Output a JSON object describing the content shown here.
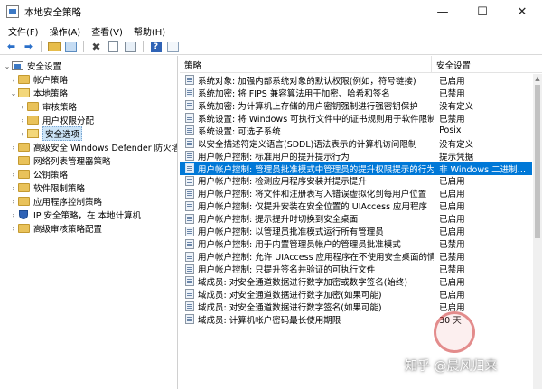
{
  "window": {
    "title": "本地安全策略",
    "minimize_glyph": "—",
    "maximize_glyph": "☐",
    "close_glyph": "✕"
  },
  "menu": [
    "文件(F)",
    "操作(A)",
    "查看(V)",
    "帮助(H)"
  ],
  "tree": {
    "items": [
      {
        "label": "安全设置",
        "level": 0,
        "chevron": "⌄",
        "icon": "computer-icon"
      },
      {
        "label": "帐户策略",
        "level": 1,
        "chevron": "›",
        "icon": "folder-icon"
      },
      {
        "label": "本地策略",
        "level": 1,
        "chevron": "⌄",
        "icon": "folder-open-icon"
      },
      {
        "label": "审核策略",
        "level": 2,
        "chevron": "›",
        "icon": "folder-icon"
      },
      {
        "label": "用户权限分配",
        "level": 2,
        "chevron": "›",
        "icon": "folder-icon"
      },
      {
        "label": "安全选项",
        "level": 2,
        "chevron": "›",
        "icon": "folder-icon",
        "selected": true
      },
      {
        "label": "高级安全 Windows Defender 防火墙",
        "level": 1,
        "chevron": "›",
        "icon": "folder-icon"
      },
      {
        "label": "网络列表管理器策略",
        "level": 1,
        "chevron": "",
        "icon": "folder-icon"
      },
      {
        "label": "公钥策略",
        "level": 1,
        "chevron": "›",
        "icon": "folder-icon"
      },
      {
        "label": "软件限制策略",
        "level": 1,
        "chevron": "›",
        "icon": "folder-icon"
      },
      {
        "label": "应用程序控制策略",
        "level": 1,
        "chevron": "›",
        "icon": "folder-icon"
      },
      {
        "label": "IP 安全策略，在 本地计算机",
        "level": 1,
        "chevron": "›",
        "icon": "shield-icon"
      },
      {
        "label": "高级审核策略配置",
        "level": 1,
        "chevron": "›",
        "icon": "folder-icon"
      }
    ]
  },
  "list": {
    "headers": {
      "policy": "策略",
      "setting": "安全设置"
    },
    "rows": [
      {
        "policy": "系统对象: 加强内部系统对象的默认权限(例如，符号链接)",
        "setting": "已启用"
      },
      {
        "policy": "系统加密: 将 FIPS 兼容算法用于加密、哈希和签名",
        "setting": "已禁用"
      },
      {
        "policy": "系统加密: 为计算机上存储的用户密钥强制进行强密钥保护",
        "setting": "没有定义"
      },
      {
        "policy": "系统设置: 将 Windows 可执行文件中的证书规则用于软件限制策略",
        "setting": "已禁用"
      },
      {
        "policy": "系统设置: 可选子系统",
        "setting": "Posix"
      },
      {
        "policy": "以安全描述符定义语言(SDDL)语法表示的计算机访问限制",
        "setting": "没有定义"
      },
      {
        "policy": "用户帐户控制: 标准用户的提升提示行为",
        "setting": "提示凭据"
      },
      {
        "policy": "用户帐户控制: 管理员批准模式中管理员的提升权限提示的行为",
        "setting": "非 Windows 二进制文件的同意提示",
        "selected": true
      },
      {
        "policy": "用户帐户控制: 检测应用程序安装并提示提升",
        "setting": "已启用"
      },
      {
        "policy": "用户帐户控制: 将文件和注册表写入错误虚拟化到每用户位置",
        "setting": "已启用"
      },
      {
        "policy": "用户帐户控制: 仅提升安装在安全位置的 UIAccess 应用程序",
        "setting": "已启用"
      },
      {
        "policy": "用户帐户控制: 提示提升时切换到安全桌面",
        "setting": "已启用"
      },
      {
        "policy": "用户帐户控制: 以管理员批准模式运行所有管理员",
        "setting": "已启用"
      },
      {
        "policy": "用户帐户控制: 用于内置管理员帐户的管理员批准模式",
        "setting": "已禁用"
      },
      {
        "policy": "用户帐户控制: 允许 UIAccess 应用程序在不使用安全桌面的情况下提升权限",
        "setting": "已禁用"
      },
      {
        "policy": "用户帐户控制: 只提升签名并验证的可执行文件",
        "setting": "已禁用"
      },
      {
        "policy": "域成员: 对安全通道数据进行数字加密或数字签名(始终)",
        "setting": "已启用"
      },
      {
        "policy": "域成员: 对安全通道数据进行数字加密(如果可能)",
        "setting": "已启用"
      },
      {
        "policy": "域成员: 对安全通道数据进行数字签名(如果可能)",
        "setting": "已启用"
      },
      {
        "policy": "域成员: 计算机帐户密码最长使用期限",
        "setting": "30 天"
      }
    ]
  },
  "watermark": {
    "text": "知乎 @晨风归来"
  },
  "colors": {
    "selection": "#0078d7",
    "tree_selection": "#cce4f7"
  }
}
